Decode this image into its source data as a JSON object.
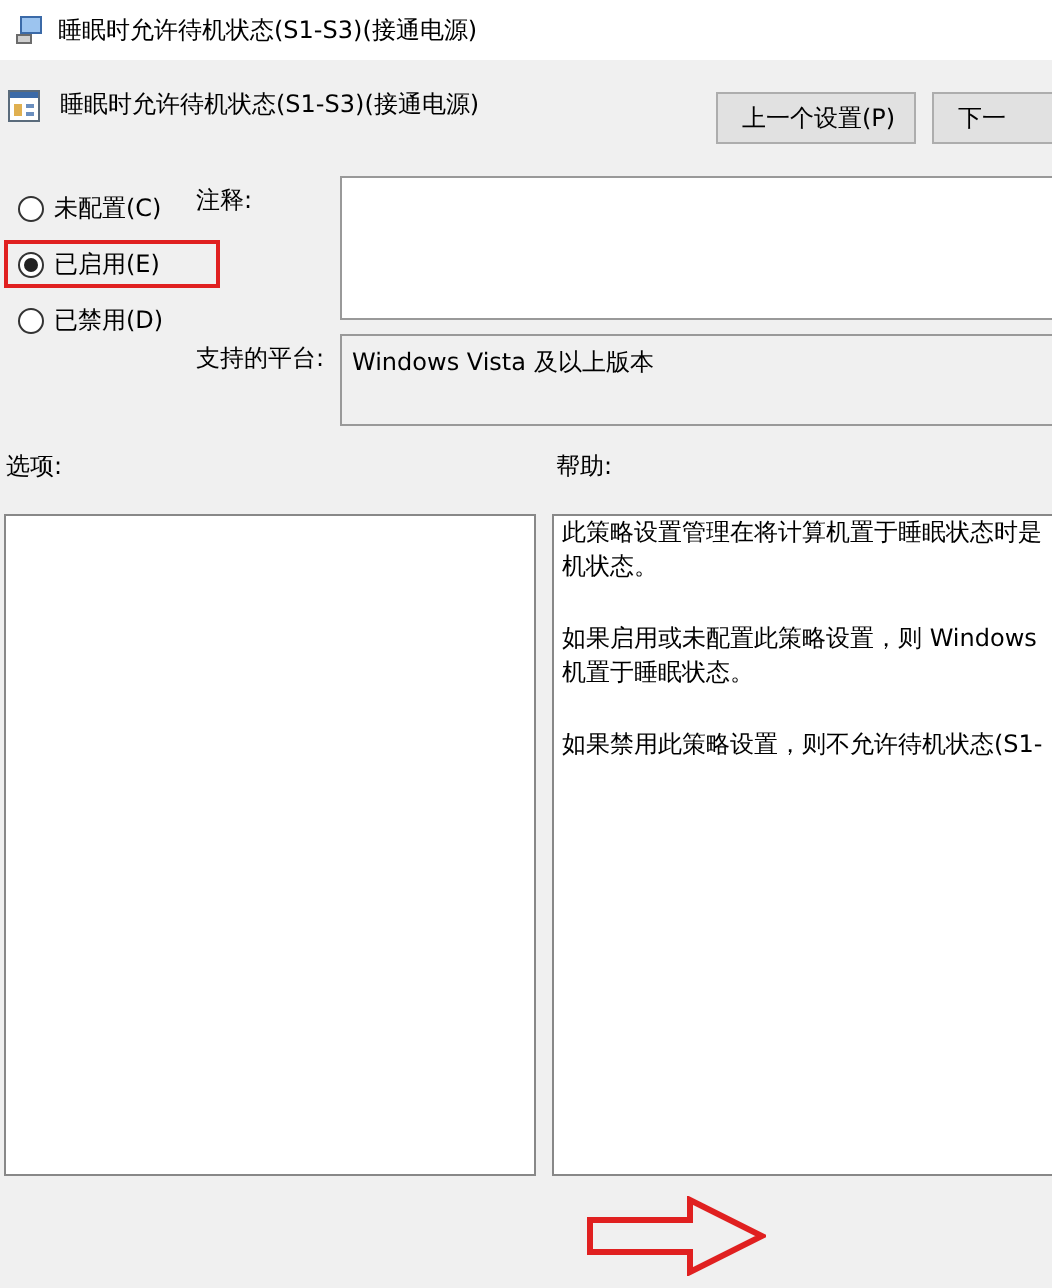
{
  "window": {
    "title": "睡眠时允许待机状态(S1-S3)(接通电源)"
  },
  "header": {
    "title": "睡眠时允许待机状态(S1-S3)(接通电源)",
    "buttons": [
      "上一个设置(P)",
      "下一"
    ]
  },
  "states": [
    {
      "label": "未配置(C)",
      "selected": false,
      "highlighted": false
    },
    {
      "label": "已启用(E)",
      "selected": true,
      "highlighted": true
    },
    {
      "label": "已禁用(D)",
      "selected": false,
      "highlighted": false
    }
  ],
  "comment": {
    "label": "注释:"
  },
  "platform": {
    "label": "支持的平台:",
    "value": "Windows Vista 及以上版本"
  },
  "options": {
    "label": "选项:"
  },
  "help": {
    "label": "帮助:",
    "paragraphs": [
      [
        "此策略设置管理在将计算机置于睡眠状态时是",
        "机状态。"
      ],
      [
        "如果启用或未配置此策略设置，则 Windows",
        "机置于睡眠状态。"
      ],
      [
        "如果禁用此策略设置，则不允许待机状态(S1-"
      ]
    ]
  }
}
